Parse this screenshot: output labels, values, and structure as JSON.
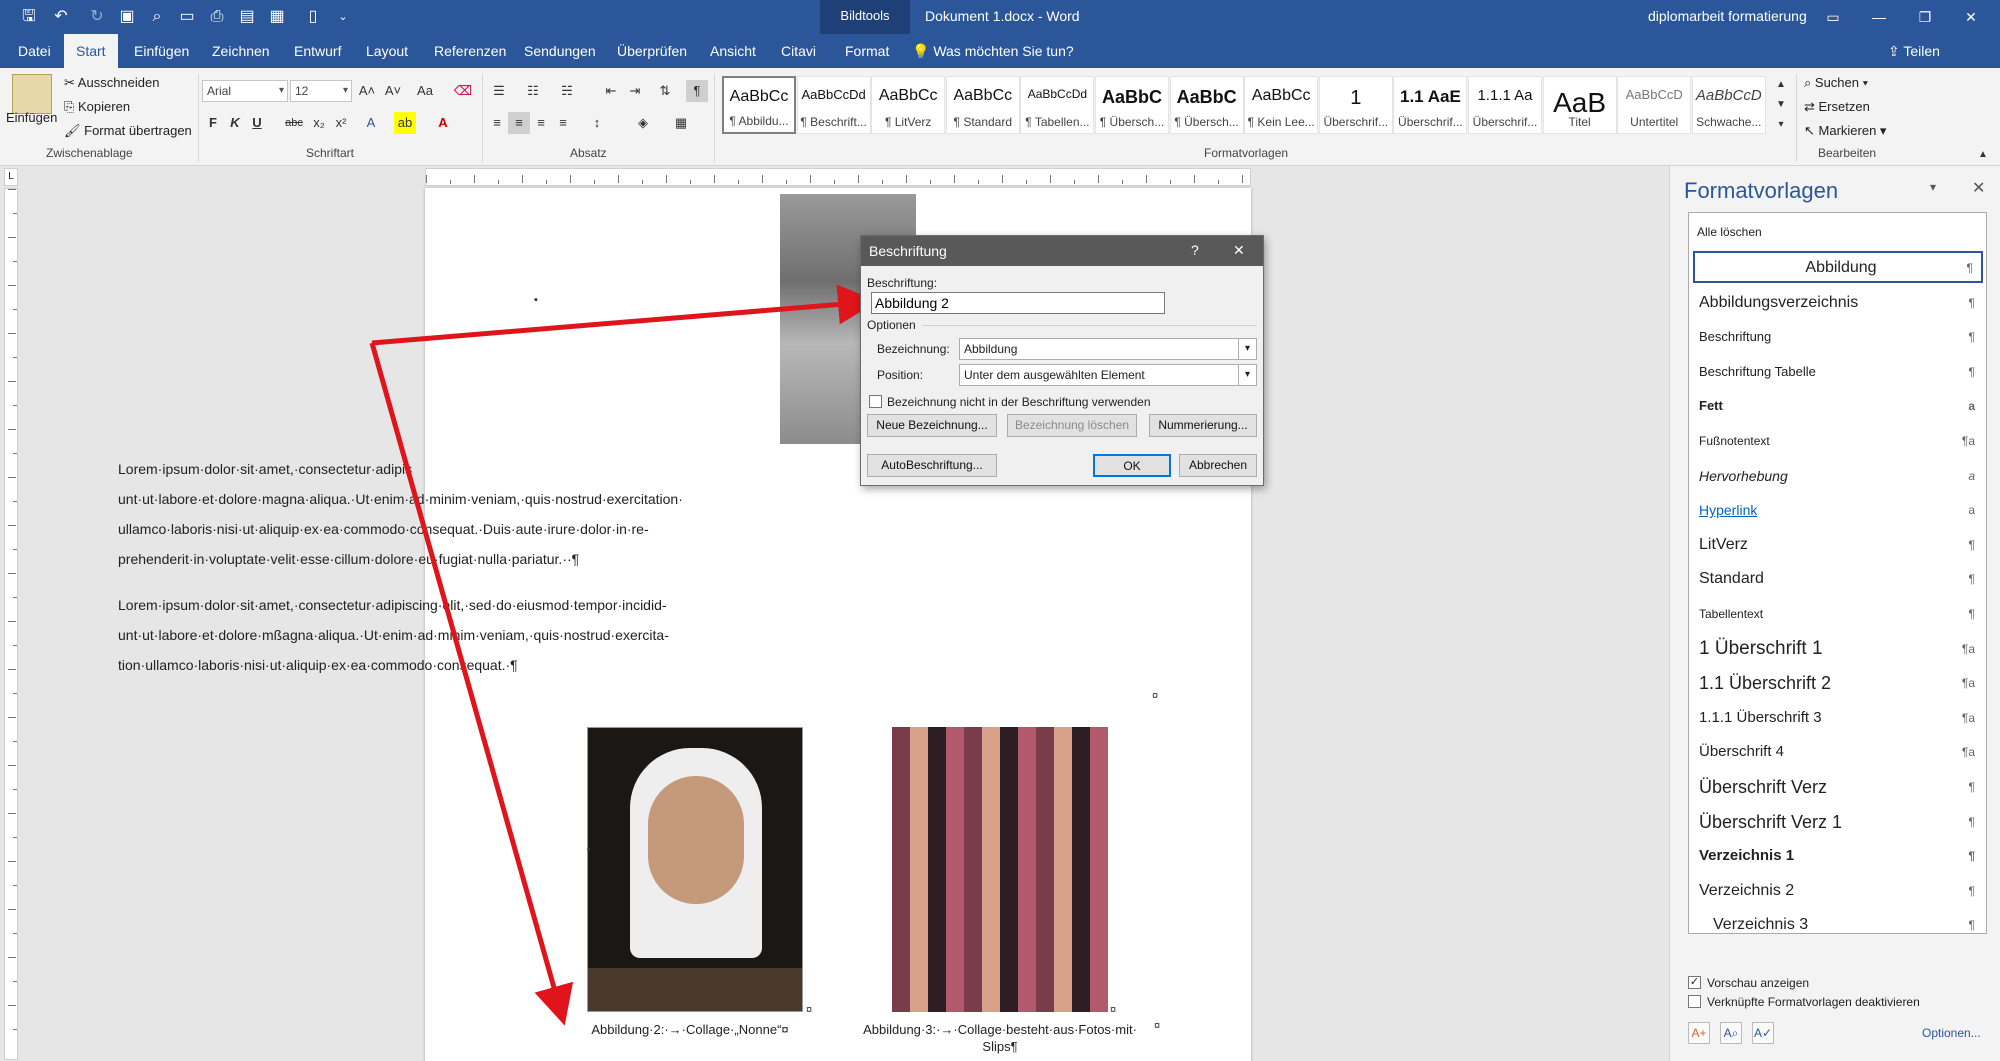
{
  "titlebar": {
    "context_tab": "Bildtools",
    "doc_title": "Dokument 1.docx  -  Word",
    "account": "diplomarbeit formatierung",
    "qat_icons": [
      "save-icon",
      "undo-icon",
      "redo-icon",
      "save-as-icon",
      "print-preview-icon",
      "open-icon",
      "print-icon",
      "view-icon",
      "table-icon",
      "new-doc-icon",
      "customize-icon"
    ]
  },
  "tabs": [
    "Datei",
    "Start",
    "Einfügen",
    "Zeichnen",
    "Entwurf",
    "Layout",
    "Referenzen",
    "Sendungen",
    "Überprüfen",
    "Ansicht",
    "Citavi",
    "Format"
  ],
  "tellme": "Was möchten Sie tun?",
  "share": "Teilen",
  "ribbon": {
    "clipboard": {
      "paste": "Einfügen",
      "cut": "Ausschneiden",
      "copy": "Kopieren",
      "format_painter": "Format übertragen",
      "label": "Zwischenablage"
    },
    "font": {
      "family": "Arial",
      "size": "12",
      "label": "Schriftart",
      "bold": "F",
      "italic": "K",
      "underline": "U",
      "strike": "abc",
      "sub": "x₂",
      "sup": "x²",
      "case": "Aa"
    },
    "paragraph": {
      "label": "Absatz"
    },
    "styles": {
      "label": "Formatvorlagen",
      "tiles": [
        {
          "preview": "AaBbCc",
          "name": "¶ Abbildu..."
        },
        {
          "preview": "AaBbCcDd",
          "name": "¶ Beschrift..."
        },
        {
          "preview": "AaBbCc",
          "name": "¶ LitVerz"
        },
        {
          "preview": "AaBbCc",
          "name": "¶ Standard"
        },
        {
          "preview": "AaBbCcDd",
          "name": "¶ Tabellen..."
        },
        {
          "preview": "AaBbC",
          "name": "¶ Übersch..."
        },
        {
          "preview": "AaBbC",
          "name": "¶ Übersch..."
        },
        {
          "preview": "AaBbCc",
          "name": "¶ Kein Lee..."
        },
        {
          "preview": "1",
          "name": "Überschrif..."
        },
        {
          "preview": "1.1 AaE",
          "name": "Überschrif..."
        },
        {
          "preview": "1.1.1 Aa",
          "name": "Überschrif..."
        },
        {
          "preview": "AaB",
          "name": "Titel"
        },
        {
          "preview": "AaBbCcD",
          "name": "Untertitel"
        },
        {
          "preview": "AaBbCcD",
          "name": "Schwache..."
        }
      ]
    },
    "editing": {
      "label": "Bearbeiten",
      "find": "Suchen",
      "replace": "Ersetzen",
      "select": "Markieren"
    }
  },
  "document": {
    "para1": [
      "Lorem·ipsum·dolor·sit·amet,·consectetur·adipis",
      "unt·ut·labore·et·dolore·magna·aliqua.·Ut·enim·ad·minim·veniam,·quis·nostrud·exercitation·",
      "ullamco·laboris·nisi·ut·aliquip·ex·ea·commodo·consequat.·Duis·aute·irure·dolor·in·re-",
      "prehenderit·in·voluptate·velit·esse·cillum·dolore·eu·fugiat·nulla·pariatur.··¶"
    ],
    "para2": [
      "Lorem·ipsum·dolor·sit·amet,·consectetur·adipiscing·elit,·sed·do·eiusmod·tempor·incidid-",
      "unt·ut·labore·et·dolore·mßagna·aliqua.·Ut·enim·ad·minim·veniam,·quis·nostrud·exercita-",
      "tion·ullamco·laboris·nisi·ut·aliquip·ex·ea·commodo·consequat.·¶"
    ],
    "caption1": "Abbildung·2:·→·Collage·„Nonne“¤",
    "caption2a": "Abbildung·3:·→·Collage·besteht·aus·Fotos·mit·",
    "caption2b": "Slips¶",
    "cell_mark": "¤"
  },
  "dialog": {
    "title": "Beschriftung",
    "help": "?",
    "close": "✕",
    "caption_label": "Beschriftung:",
    "caption_value": "Abbildung 2",
    "options": "Optionen",
    "label_label": "Bezeichnung:",
    "label_value": "Abbildung",
    "position_label": "Position:",
    "position_value": "Unter dem ausgewählten Element",
    "exclude_label": "Bezeichnung nicht in der Beschriftung verwenden",
    "new_label": "Neue Bezeichnung...",
    "delete_label": "Bezeichnung löschen",
    "numbering": "Nummerierung...",
    "autocaption": "AutoBeschriftung...",
    "ok": "OK",
    "cancel": "Abbrechen"
  },
  "pane": {
    "title": "Formatvorlagen",
    "clear_all": "Alle löschen",
    "items": [
      {
        "label": "Abbildung",
        "sym": "¶"
      },
      {
        "label": "Abbildungsverzeichnis",
        "sym": "¶"
      },
      {
        "label": "Beschriftung",
        "sym": "¶"
      },
      {
        "label": "Beschriftung Tabelle",
        "sym": "¶"
      },
      {
        "label": "Fett",
        "sym": "a"
      },
      {
        "label": "Fußnotentext",
        "sym": "¶a"
      },
      {
        "label": "Hervorhebung",
        "sym": "a"
      },
      {
        "label": "Hyperlink",
        "sym": "a"
      },
      {
        "label": "LitVerz",
        "sym": "¶"
      },
      {
        "label": "Standard",
        "sym": "¶"
      },
      {
        "label": "Tabellentext",
        "sym": "¶"
      },
      {
        "label": "1  Überschrift 1",
        "sym": "¶a"
      },
      {
        "label": "1.1  Überschrift 2",
        "sym": "¶a"
      },
      {
        "label": "1.1.1  Überschrift 3",
        "sym": "¶a"
      },
      {
        "label": "Überschrift 4",
        "sym": "¶a"
      },
      {
        "label": "Überschrift Verz",
        "sym": "¶"
      },
      {
        "label": "Überschrift Verz 1",
        "sym": "¶"
      },
      {
        "label": "Verzeichnis 1",
        "sym": "¶"
      },
      {
        "label": "Verzeichnis 2",
        "sym": "¶"
      },
      {
        "label": "Verzeichnis 3",
        "sym": "¶"
      }
    ],
    "show_preview": "Vorschau anzeigen",
    "disable_linked": "Verknüpfte Formatvorlagen deaktivieren",
    "options": "Optionen..."
  },
  "colors": {
    "accent": "#2b579a",
    "arrow": "#e0141b"
  }
}
